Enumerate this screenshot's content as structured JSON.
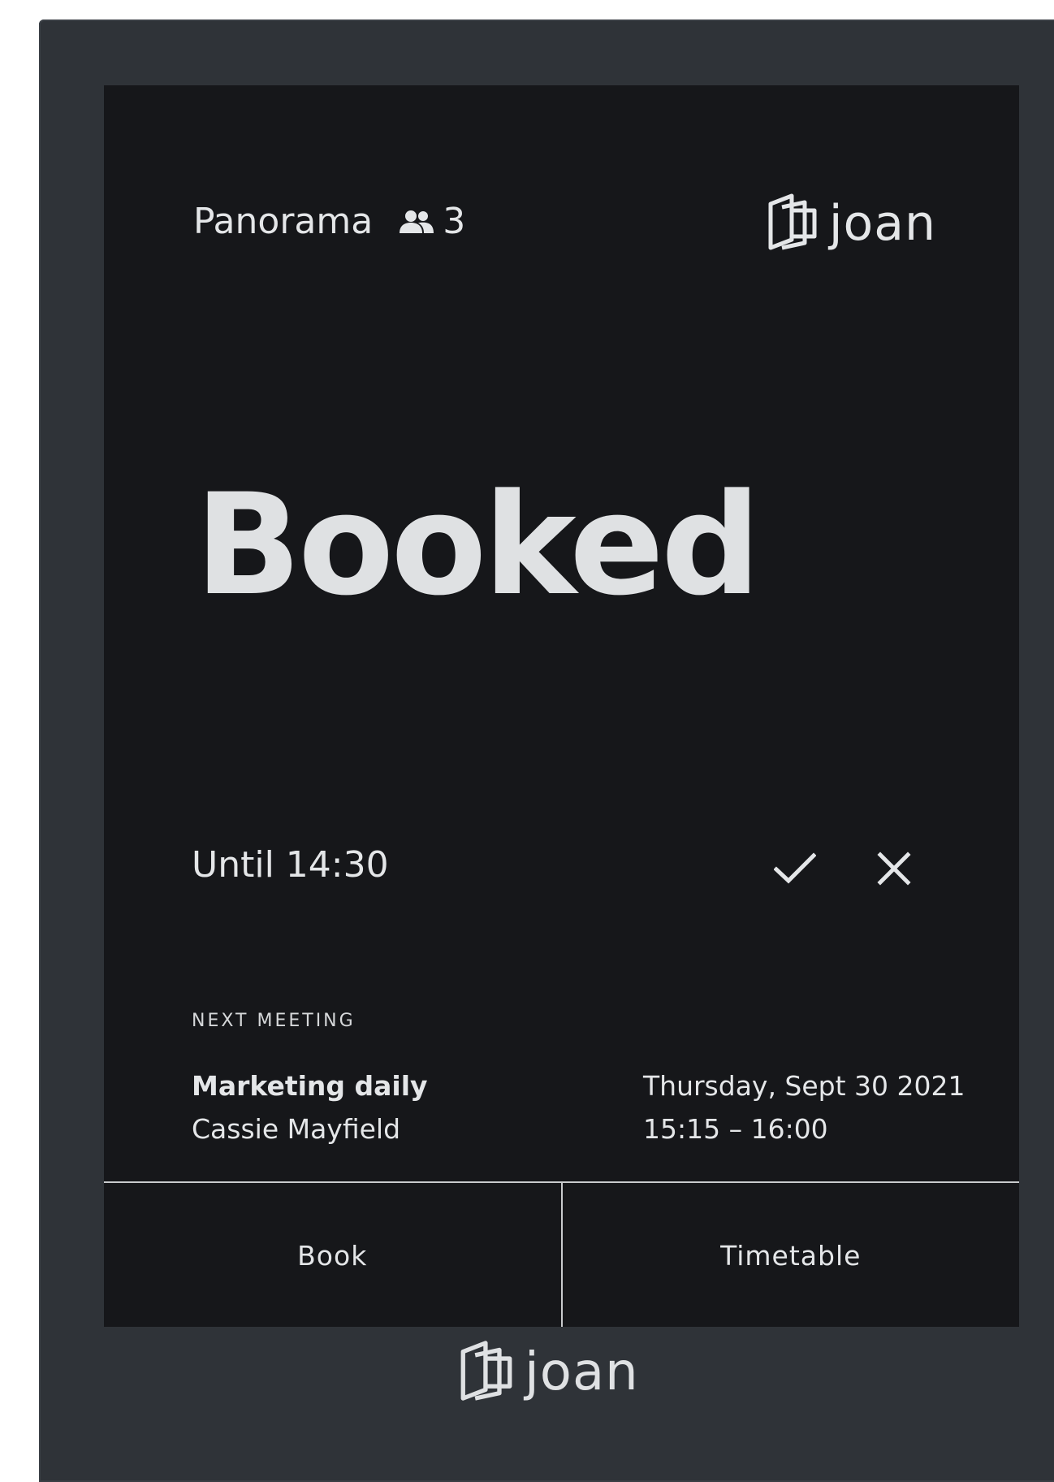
{
  "header": {
    "room_name": "Panorama",
    "capacity": "3",
    "capacity_icon": "people-icon"
  },
  "brand": {
    "name": "joan",
    "icon": "joan-logo-icon"
  },
  "status": {
    "label": "Booked",
    "until": "Until 14:30"
  },
  "actions": {
    "confirm_icon": "check-icon",
    "cancel_icon": "close-icon"
  },
  "next_meeting": {
    "label": "NEXT MEETING",
    "title": "Marketing daily",
    "organizer": "Cassie Mayfield",
    "date": "Thursday, Sept 30 2021",
    "time": "15:15 – 16:00"
  },
  "bottom_bar": {
    "book_label": "Book",
    "timetable_label": "Timetable"
  },
  "colors": {
    "screen_bg": "#16171a",
    "bezel": "#2f3338",
    "text": "#e4e6e8"
  }
}
